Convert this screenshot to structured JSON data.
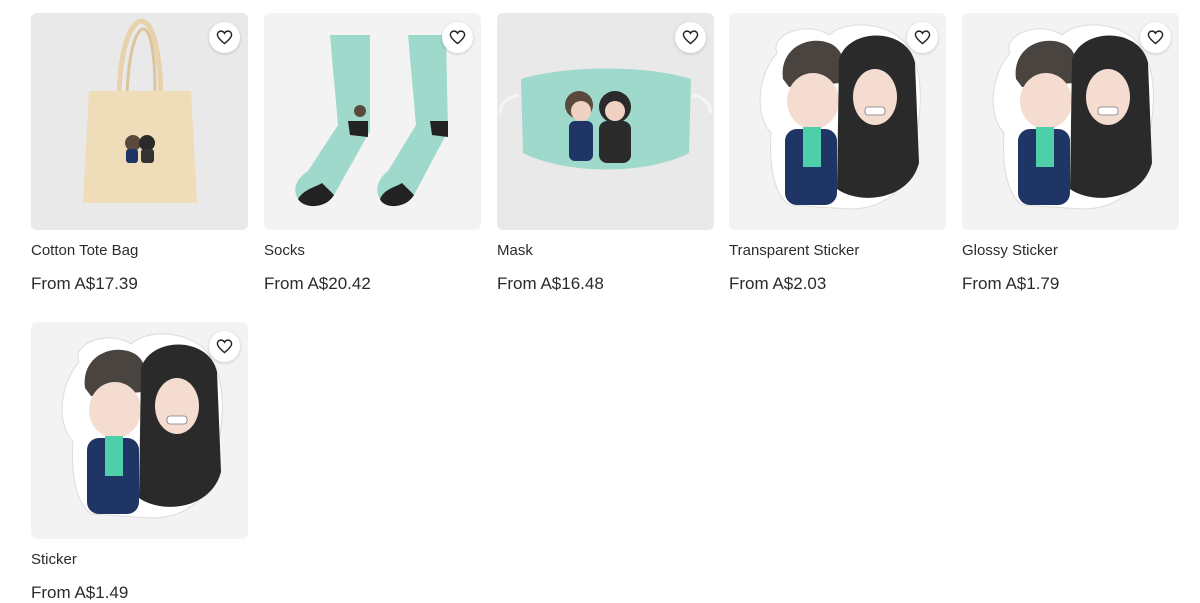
{
  "products": [
    {
      "name": "cotton-tote-bag",
      "title": "Cotton Tote Bag",
      "price": "From A$17.39",
      "favorite_icon": "heart-outline-icon"
    },
    {
      "name": "socks",
      "title": "Socks",
      "price": "From A$20.42",
      "favorite_icon": "heart-outline-icon"
    },
    {
      "name": "mask",
      "title": "Mask",
      "price": "From A$16.48",
      "favorite_icon": "heart-outline-icon"
    },
    {
      "name": "transparent-sticker",
      "title": "Transparent Sticker",
      "price": "From A$2.03",
      "favorite_icon": "heart-outline-icon"
    },
    {
      "name": "glossy-sticker",
      "title": "Glossy Sticker",
      "price": "From A$1.79",
      "favorite_icon": "heart-outline-icon"
    },
    {
      "name": "sticker",
      "title": "Sticker",
      "price": "From A$1.49",
      "favorite_icon": "heart-outline-icon"
    }
  ],
  "colors": {
    "thumb_bg": "#f3f3f3",
    "mint": "#9fd9cc",
    "tote": "#efdcb9",
    "hoodie": "#2a2a2a",
    "jacket": "#1f3566"
  }
}
